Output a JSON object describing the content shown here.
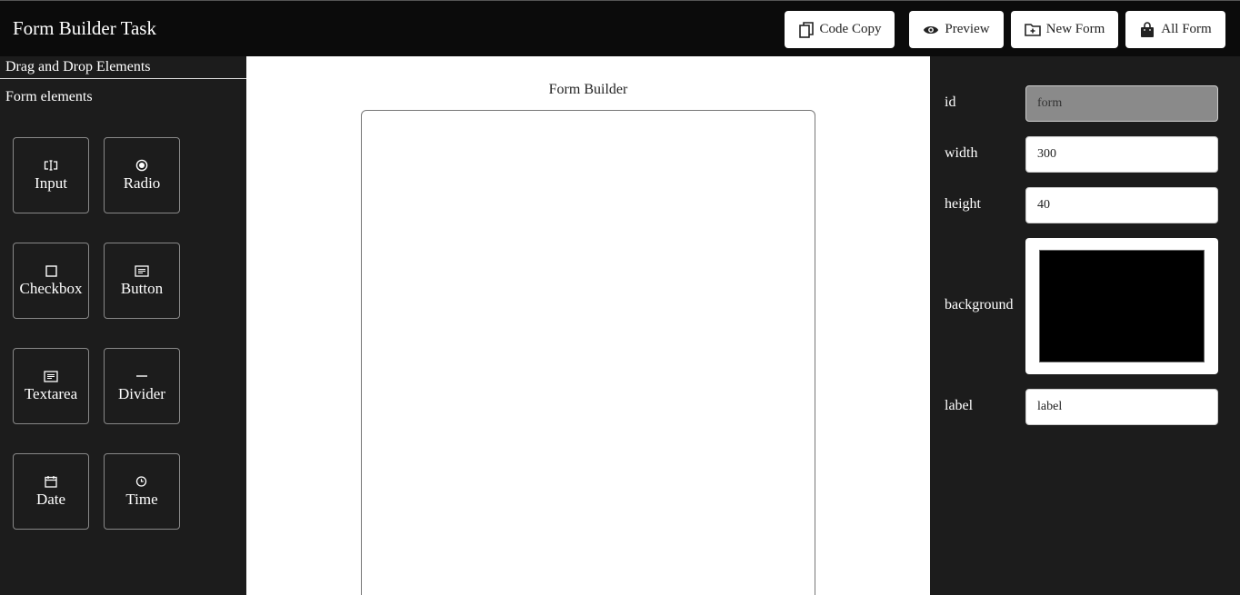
{
  "app": {
    "title": "Form Builder Task"
  },
  "header": {
    "buttons": [
      {
        "label": "Code Copy",
        "icon": "copy-icon"
      },
      {
        "label": "Preview",
        "icon": "eye-icon"
      },
      {
        "label": "New Form",
        "icon": "folder-plus-icon"
      },
      {
        "label": "All Form",
        "icon": "bag-icon"
      }
    ]
  },
  "sidebar": {
    "heading": "Drag and Drop Elements",
    "subheading": "Form elements",
    "elements": [
      {
        "label": "Input",
        "icon": "text-cursor-icon"
      },
      {
        "label": "Radio",
        "icon": "radio-icon"
      },
      {
        "label": "Checkbox",
        "icon": "checkbox-icon"
      },
      {
        "label": "Button",
        "icon": "button-icon"
      },
      {
        "label": "Textarea",
        "icon": "textarea-icon"
      },
      {
        "label": "Divider",
        "icon": "divider-icon"
      },
      {
        "label": "Date",
        "icon": "calendar-icon"
      },
      {
        "label": "Time",
        "icon": "clock-icon"
      }
    ]
  },
  "canvas": {
    "title": "Form Builder"
  },
  "properties": {
    "heading": "",
    "fields": {
      "id": {
        "label": "id",
        "value": "form"
      },
      "width": {
        "label": "width",
        "value": "300"
      },
      "height": {
        "label": "height",
        "value": "40"
      },
      "background": {
        "label": "background",
        "value": "#000000"
      },
      "label": {
        "label": "label",
        "value": "label"
      }
    }
  },
  "colors": {
    "header_bg": "#0b0b0b",
    "panel_bg": "#1c1c1c",
    "canvas_bg": "#ffffff"
  }
}
